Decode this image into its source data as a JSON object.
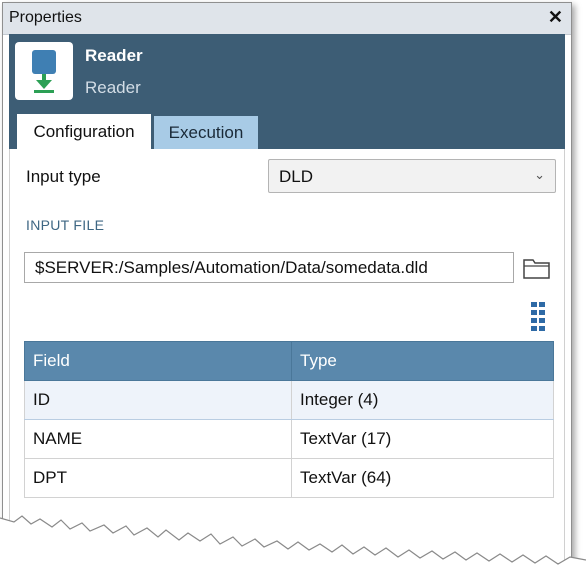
{
  "window": {
    "title": "Properties",
    "close_glyph": "✕"
  },
  "node": {
    "name": "Reader",
    "subtitle": "Reader",
    "icon": "reader-download-icon"
  },
  "tabs": [
    {
      "label": "Configuration",
      "active": true
    },
    {
      "label": "Execution",
      "active": false
    }
  ],
  "config": {
    "input_type_label": "Input type",
    "input_type_value": "DLD",
    "input_file_section": "INPUT FILE",
    "input_file_path": "$SERVER:/Samples/Automation/Data/somedata.dld"
  },
  "fields_table": {
    "headers": [
      "Field",
      "Type"
    ],
    "rows": [
      {
        "field": "ID",
        "type": "Integer (4)"
      },
      {
        "field": "NAME",
        "type": "TextVar (17)"
      },
      {
        "field": "DPT",
        "type": "TextVar (64)"
      }
    ]
  },
  "colors": {
    "header_bg": "#3d5d75",
    "table_header": "#5a88ac",
    "inactive_tab": "#a8cbe6",
    "section_label": "#3d6683"
  }
}
